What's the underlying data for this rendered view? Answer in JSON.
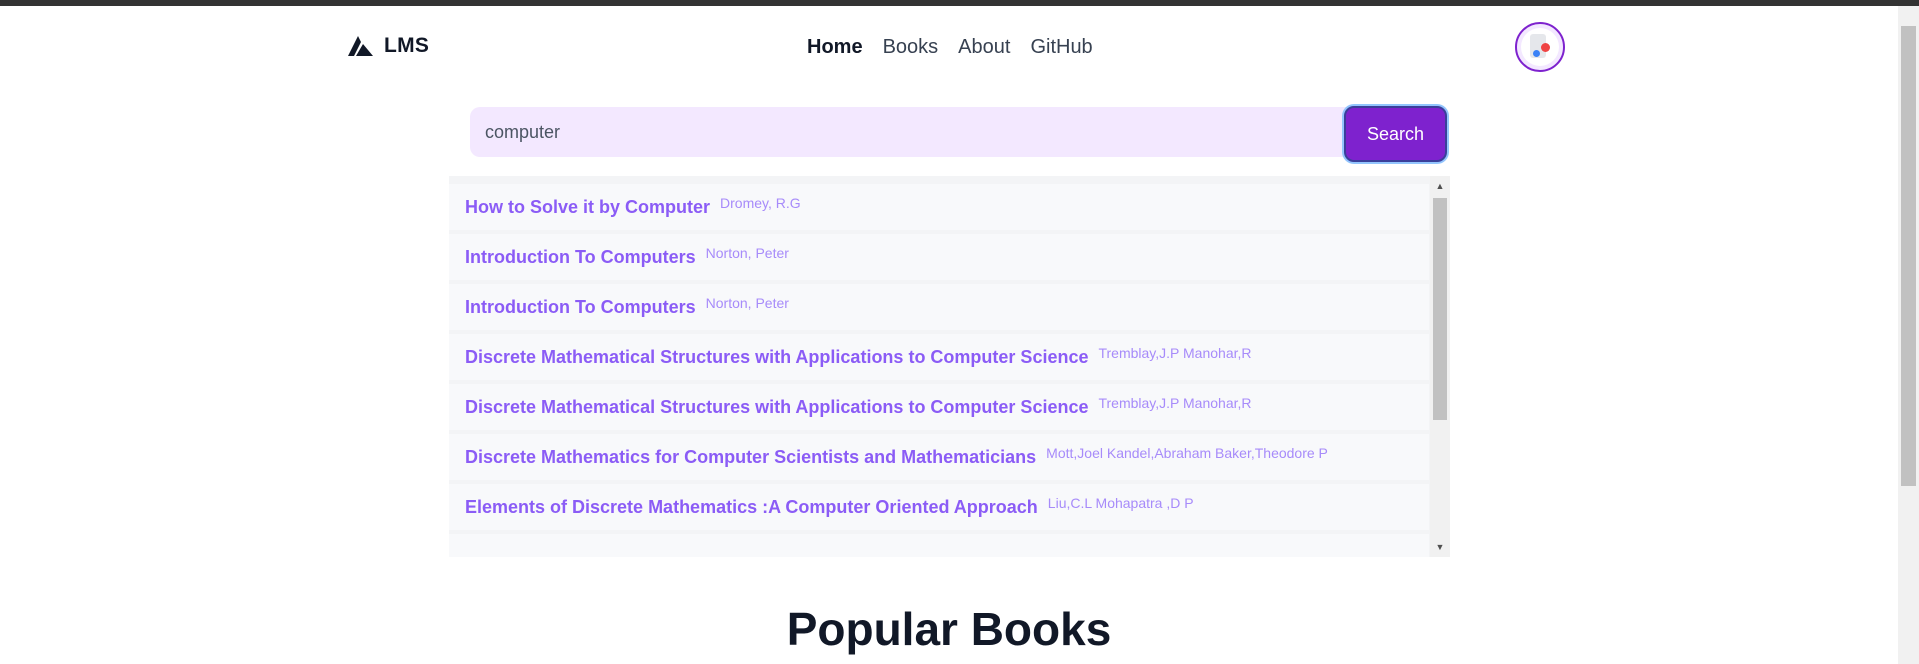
{
  "brand": {
    "name": "LMS",
    "icon": "triangle-logo-icon"
  },
  "nav": {
    "items": [
      {
        "label": "Home",
        "active": true
      },
      {
        "label": "Books",
        "active": false
      },
      {
        "label": "About",
        "active": false
      },
      {
        "label": "GitHub",
        "active": false
      }
    ]
  },
  "avatar": {
    "icon": "avatar-icon"
  },
  "search": {
    "value": "computer",
    "button_label": "Search"
  },
  "results": [
    {
      "title": "How to Solve it by Computer",
      "author": "Dromey, R.G"
    },
    {
      "title": "Introduction To Computers",
      "author": "Norton, Peter"
    },
    {
      "title": "Introduction To Computers",
      "author": "Norton, Peter"
    },
    {
      "title": "Discrete Mathematical Structures with Applications to Computer Science",
      "author": "Tremblay,J.P Manohar,R"
    },
    {
      "title": "Discrete Mathematical Structures with Applications to Computer Science",
      "author": "Tremblay,J.P Manohar,R"
    },
    {
      "title": "Discrete Mathematics for Computer Scientists and Mathematicians",
      "author": "Mott,Joel Kandel,Abraham Baker,Theodore P"
    },
    {
      "title": "Elements of Discrete Mathematics :A Computer Oriented Approach",
      "author": "Liu,C.L Mohapatra ,D P"
    }
  ],
  "section": {
    "title": "Popular Books"
  },
  "colors": {
    "accent": "#7e22ce",
    "search_bg": "#f3e8ff",
    "result_title": "#8b5cf6",
    "result_author": "#a78bfa"
  }
}
